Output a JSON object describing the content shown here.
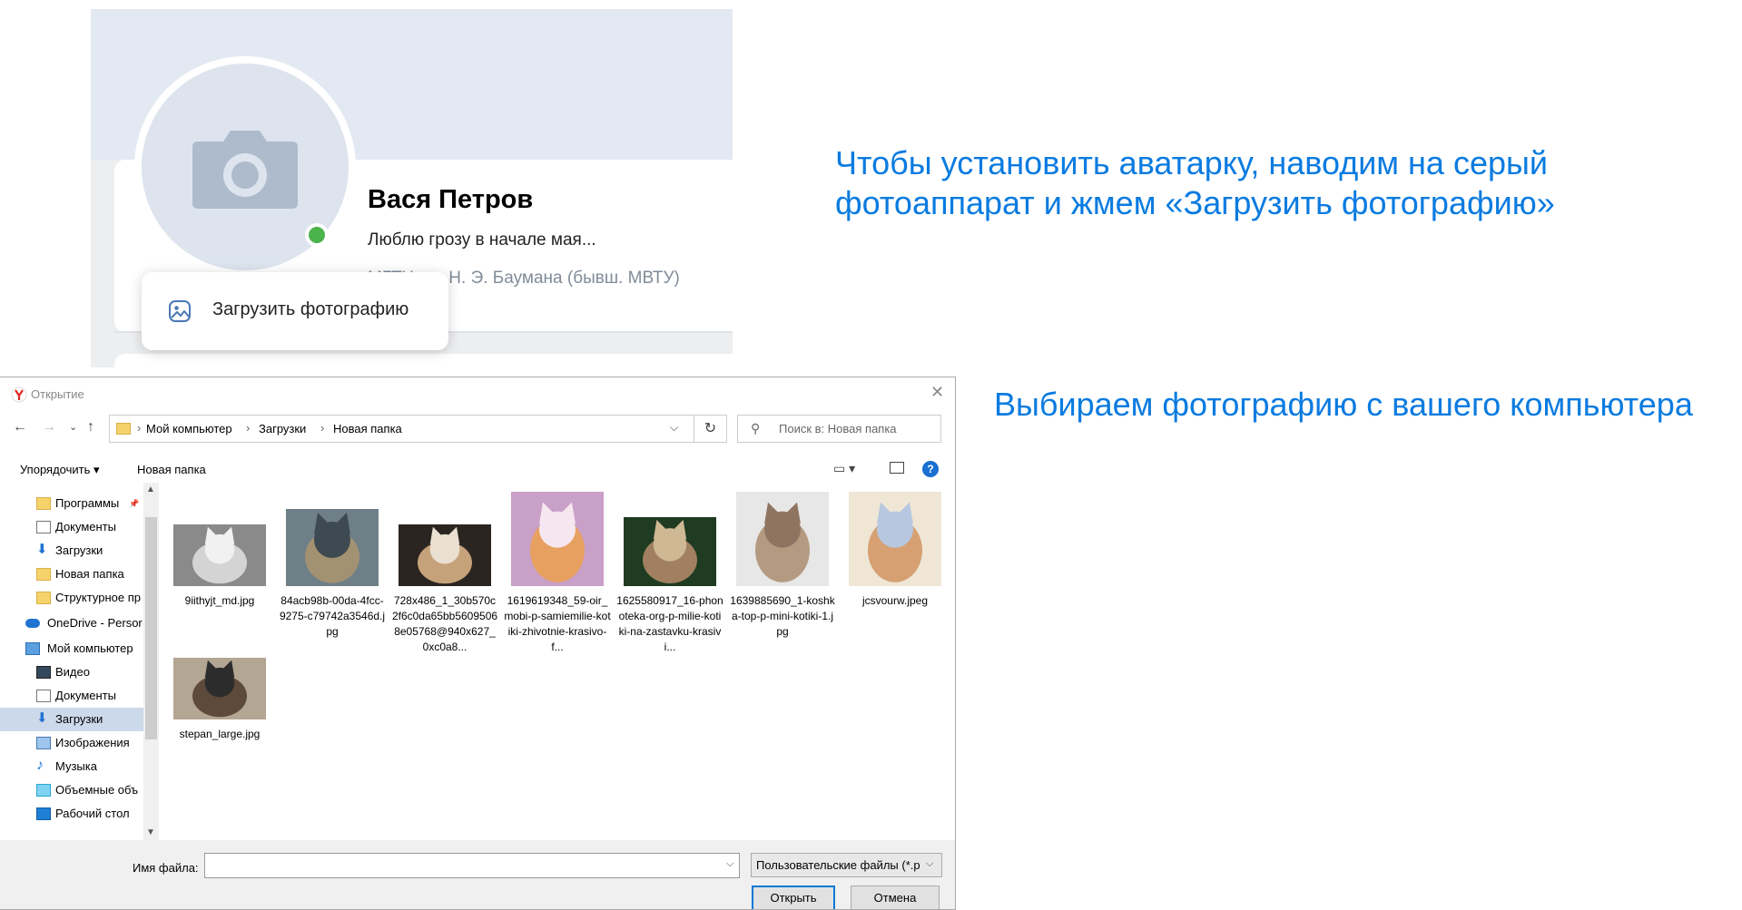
{
  "vk": {
    "name": "Вася Петров",
    "status": "Люблю грозу в начале мая...",
    "education": "МГТУ им. Н. Э. Баумана (бывш. МВТУ)",
    "upload_label": "Загрузить фотографию"
  },
  "captions": {
    "step1": "Чтобы установить аватарку, наводим на серый",
    "step1_line2": "фотоаппарат и жмем «Загрузить фотографию»",
    "step2": "Выбираем фотографию с вашего компьютера"
  },
  "dialog": {
    "title": "Открытие",
    "breadcrumbs": [
      "Мой компьютер",
      "Загрузки",
      "Новая папка"
    ],
    "search_placeholder": "Поиск в: Новая папка",
    "toolbar": {
      "organize": "Упорядочить ▾",
      "new_folder": "Новая папка"
    },
    "sidebar": [
      {
        "label": "Программы",
        "icon": "folder-icon",
        "top": false
      },
      {
        "label": "Документы",
        "icon": "document-icon",
        "top": false
      },
      {
        "label": "Загрузки",
        "icon": "download-icon",
        "top": false
      },
      {
        "label": "Новая папка",
        "icon": "folder-icon",
        "top": false
      },
      {
        "label": "Структурное пр",
        "icon": "folder-icon",
        "top": false
      },
      {
        "label": "OneDrive - Persor",
        "icon": "cloud-icon",
        "top": true
      },
      {
        "label": "Мой компьютер",
        "icon": "computer-icon",
        "top": true
      },
      {
        "label": "Видео",
        "icon": "video-icon",
        "top": false
      },
      {
        "label": "Документы",
        "icon": "document-icon",
        "top": false
      },
      {
        "label": "Загрузки",
        "icon": "download-icon",
        "top": false,
        "selected": true
      },
      {
        "label": "Изображения",
        "icon": "image-icon",
        "top": false
      },
      {
        "label": "Музыка",
        "icon": "music-icon",
        "top": false
      },
      {
        "label": "Объемные объ",
        "icon": "cube-icon",
        "top": false
      },
      {
        "label": "Рабочий стол",
        "icon": "desktop-icon",
        "top": false
      }
    ],
    "files": [
      {
        "name": "9iithyjt_md.jpg",
        "colors": [
          "#8a8a8a",
          "#d4d4d4",
          "#f1f1f1"
        ]
      },
      {
        "name": "84acb98b-00da-4fcc-9275-c79742a3546d.jpg",
        "colors": [
          "#6f7f88",
          "#a39272",
          "#3e4a52"
        ]
      },
      {
        "name": "728x486_1_30b570c2f6c0da65bb56095068e05768@940x627_0xc0a8...",
        "colors": [
          "#2a2520",
          "#c6a27a",
          "#eae0d2"
        ]
      },
      {
        "name": "1619619348_59-oir_mobi-p-samiemilie-kotiki-zhivotnie-krasivo-f...",
        "colors": [
          "#c8a0c8",
          "#e8a060",
          "#f6e6f0"
        ]
      },
      {
        "name": "1625580917_16-phonoteka-org-p-milie-kotiki-na-zastavku-krasivi...",
        "colors": [
          "#1f3b22",
          "#a08060",
          "#cfb894"
        ]
      },
      {
        "name": "1639885690_1-koshka-top-p-mini-kotiki-1.jpg",
        "colors": [
          "#e7e7e7",
          "#b59a82",
          "#8f7461"
        ]
      },
      {
        "name": "jcsvourw.jpeg",
        "colors": [
          "#efe6d6",
          "#d6a072",
          "#b7c7df"
        ]
      },
      {
        "name": "stepan_large.jpg",
        "colors": [
          "#b3a693",
          "#5e4a3a",
          "#2c2c2c"
        ]
      }
    ],
    "filename_label": "Имя файла:",
    "filename_value": "",
    "filetype": "Пользовательские файлы (*.p",
    "open_button": "Открыть",
    "cancel_button": "Отмена"
  }
}
